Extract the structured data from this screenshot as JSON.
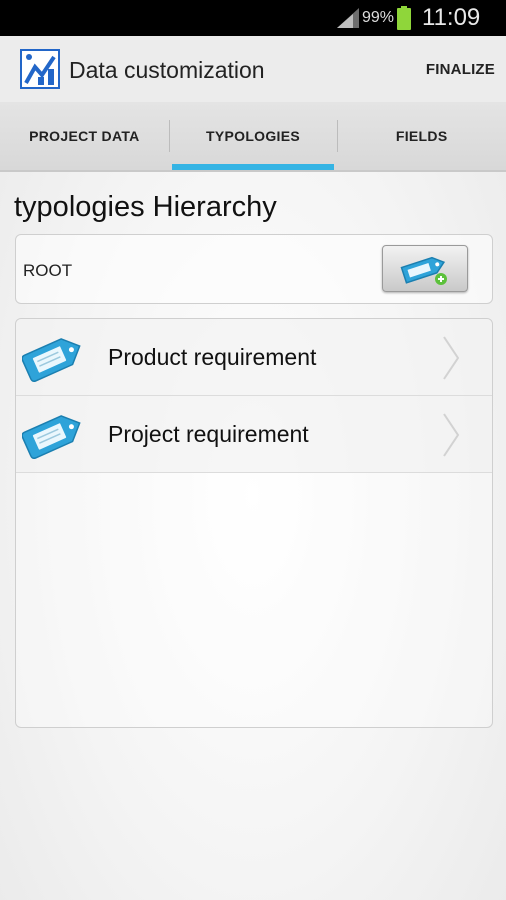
{
  "status_bar": {
    "battery": "99%",
    "time": "11:09"
  },
  "header": {
    "title": "Data customization",
    "action": "FINALIZE"
  },
  "tabs": [
    {
      "label": "PROJECT DATA",
      "active": false
    },
    {
      "label": "TYPOLOGIES",
      "active": true
    },
    {
      "label": "FIELDS",
      "active": false
    }
  ],
  "main": {
    "title": "typologies Hierarchy",
    "root": {
      "label": "ROOT",
      "button_icon": "tag-add-icon"
    },
    "items": [
      {
        "label": "Product requirement",
        "icon": "tag-icon"
      },
      {
        "label": "Project requirement",
        "icon": "tag-icon"
      }
    ]
  },
  "colors": {
    "accent": "#35b4e4",
    "tag": "#2ea3d9",
    "add_badge": "#5cc13b"
  }
}
